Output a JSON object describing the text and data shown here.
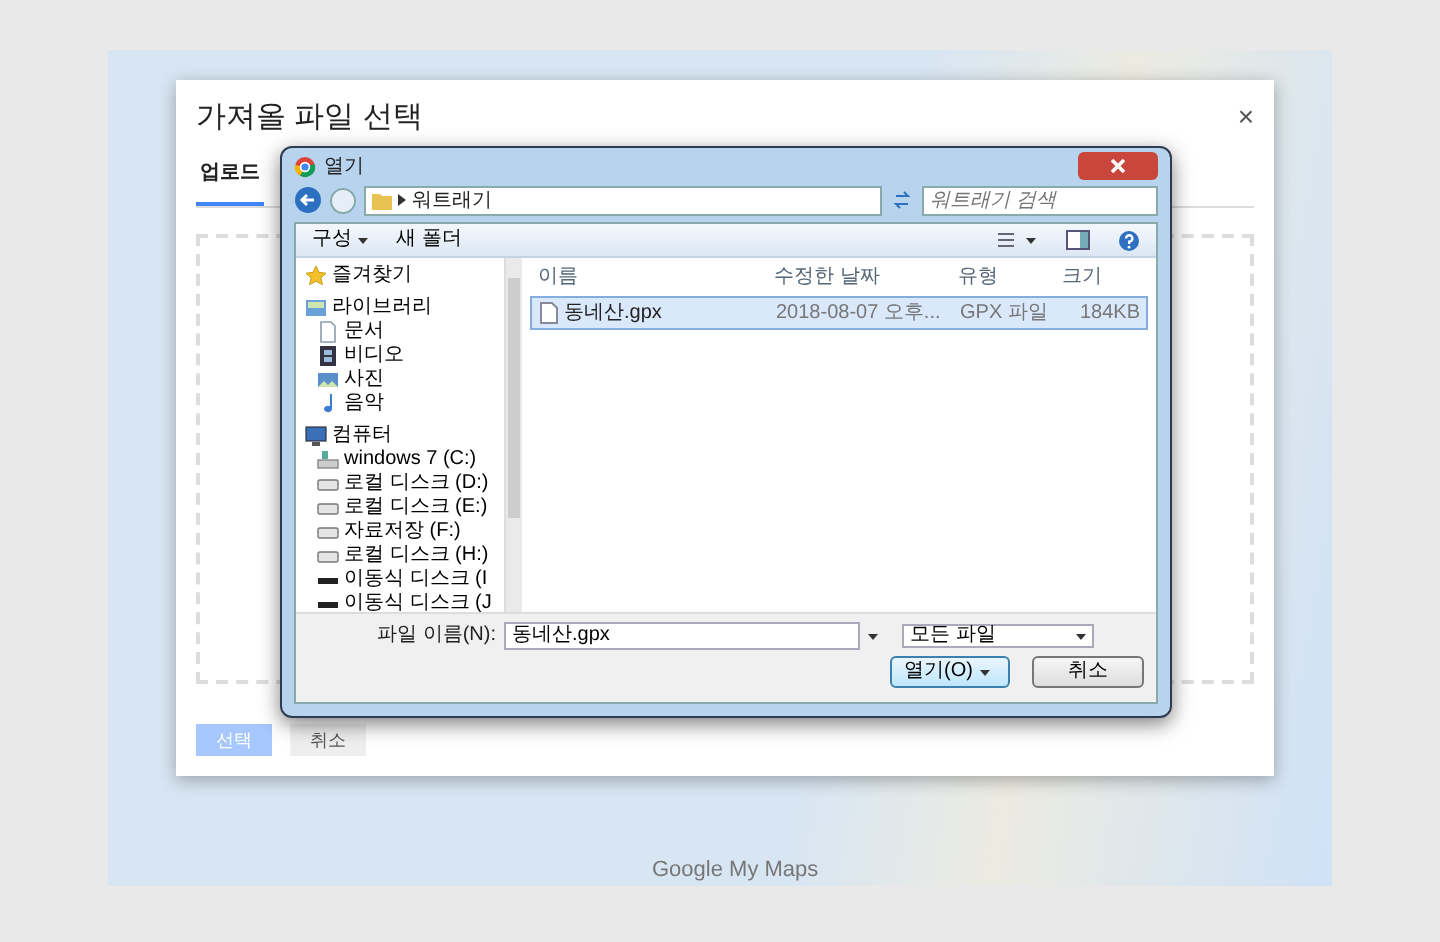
{
  "map": {
    "logo": "Google My Maps"
  },
  "import_dialog": {
    "title": "가져올 파일 선택",
    "close": "×",
    "tabs": [
      {
        "label": "업로드",
        "selected": true
      }
    ],
    "buttons": [
      {
        "label": "선택",
        "disabled": true
      },
      {
        "label": "취소",
        "disabled": false
      }
    ]
  },
  "open_dialog": {
    "title": "열기",
    "path": "워트래기",
    "search": {
      "placeholder": "워트래기 검색"
    },
    "toolbar": [
      {
        "label": "구성",
        "menu": true
      },
      {
        "label": "새 폴더",
        "menu": false
      }
    ],
    "nav": [
      {
        "label": "즐겨찾기",
        "kind": "star"
      },
      {
        "label": "라이브러리",
        "kind": "library",
        "children": [
          {
            "label": "문서",
            "kind": "document"
          },
          {
            "label": "비디오",
            "kind": "video"
          },
          {
            "label": "사진",
            "kind": "photo"
          },
          {
            "label": "음악",
            "kind": "music"
          }
        ]
      },
      {
        "label": "컴퓨터",
        "kind": "computer",
        "children": [
          {
            "label": "windows 7 (C:)",
            "kind": "system"
          },
          {
            "label": "로컬 디스크 (D:)",
            "kind": "drive"
          },
          {
            "label": "로컬 디스크 (E:)",
            "kind": "drive"
          },
          {
            "label": "자료저장 (F:)",
            "kind": "drive"
          },
          {
            "label": "로컬 디스크 (H:)",
            "kind": "drive"
          },
          {
            "label": "이동식 디스크 (I",
            "kind": "usb"
          },
          {
            "label": "이동식 디스크 (J",
            "kind": "usb"
          }
        ]
      }
    ],
    "columns": [
      "이름",
      "수정한 날짜",
      "유형",
      "크기"
    ],
    "files": [
      {
        "name": "동네산.gpx",
        "modified": "2018-08-07 오후...",
        "type": "GPX 파일",
        "size": "184KB",
        "selected": true
      }
    ],
    "filename": {
      "label": "파일 이름(N):",
      "value": "동네산.gpx"
    },
    "filter": "모든 파일",
    "buttons": [
      {
        "label": "열기(O)",
        "kind": "split"
      },
      {
        "label": "취소",
        "kind": "plain"
      }
    ]
  }
}
